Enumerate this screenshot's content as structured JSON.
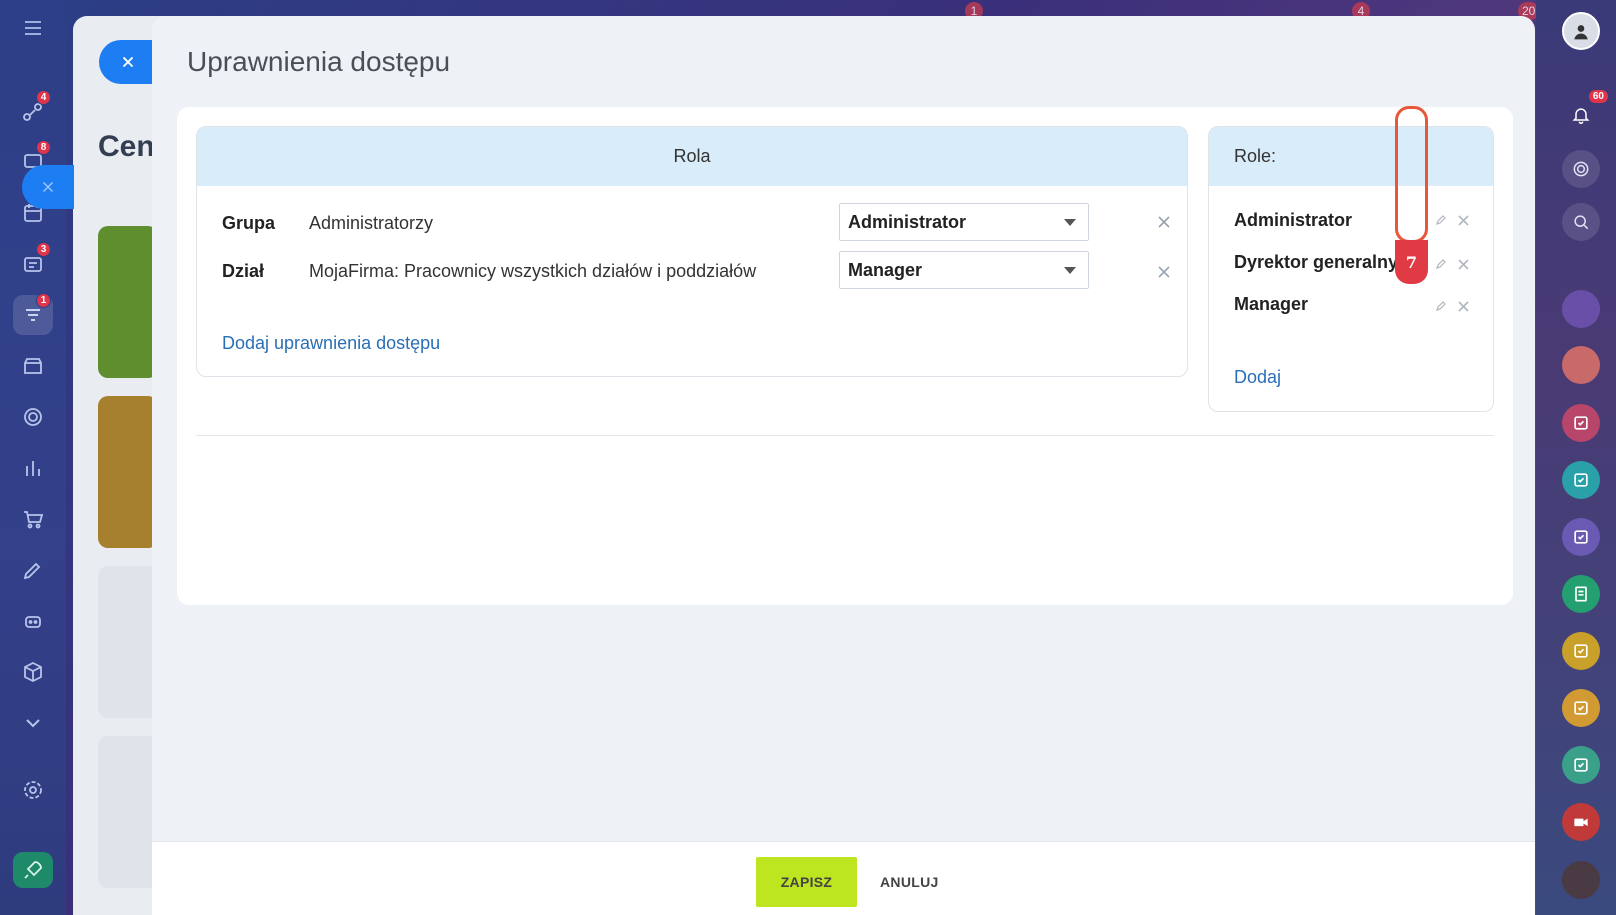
{
  "modal": {
    "title": "Uprawnienia dostępu"
  },
  "rola_panel": {
    "header": "Rola",
    "rows": [
      {
        "type": "Grupa",
        "name": "Administratorzy",
        "role": "Administrator"
      },
      {
        "type": "Dział",
        "name": "MojaFirma: Pracownicy wszystkich działów i poddziałów",
        "role": "Manager"
      }
    ],
    "add_link": "Dodaj uprawnienia dostępu"
  },
  "role_panel": {
    "header": "Role:",
    "items": [
      "Administrator",
      "Dyrektor generalny",
      "Manager"
    ],
    "add_link": "Dodaj"
  },
  "annotation": {
    "step": "7",
    "color": "#e8573a"
  },
  "footer": {
    "save_label": "ZAPISZ",
    "cancel_label": "ANULUJ"
  },
  "background_page": {
    "title_fragment": "Cen"
  },
  "left_sidebar": {
    "badges": [
      "4",
      "8",
      "3",
      "1"
    ]
  },
  "right_sidebar": {
    "notification_count": "60"
  },
  "top_counters": [
    "1",
    "4",
    "20"
  ],
  "colors": {
    "accent_blue": "#2a6fb5",
    "save_green": "#bde520",
    "header_blue": "#d8ecf9",
    "badge_red": "#e0344a"
  }
}
